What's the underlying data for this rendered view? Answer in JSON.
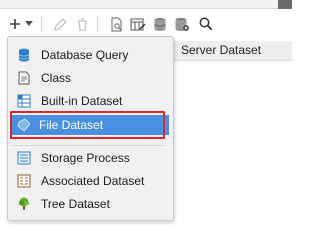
{
  "toolbar": {
    "add_icon": "plus-icon",
    "dropdown_icon": "chevron-down-icon",
    "edit_icon": "pencil-icon",
    "delete_icon": "trash-icon",
    "preview_icon": "document-preview-icon",
    "param_icon": "table-edit-icon",
    "database_icon": "database-icon",
    "database2_icon": "database-settings-icon",
    "search_icon": "search-icon"
  },
  "table": {
    "column_header": "Server Dataset"
  },
  "menu": {
    "items": [
      {
        "label": "Database Query",
        "icon": "database-icon"
      },
      {
        "label": "Class",
        "icon": "class-icon"
      },
      {
        "label": "Built-in Dataset",
        "icon": "builtin-dataset-icon"
      },
      {
        "label": "File Dataset",
        "icon": "file-dataset-icon",
        "selected": true
      },
      {
        "label": "Storage Process",
        "icon": "storage-process-icon"
      },
      {
        "label": "Associated Dataset",
        "icon": "associated-dataset-icon"
      },
      {
        "label": "Tree Dataset",
        "icon": "tree-icon"
      }
    ]
  },
  "colors": {
    "selection": "#4a90e2",
    "highlight_border": "#e0262d"
  }
}
